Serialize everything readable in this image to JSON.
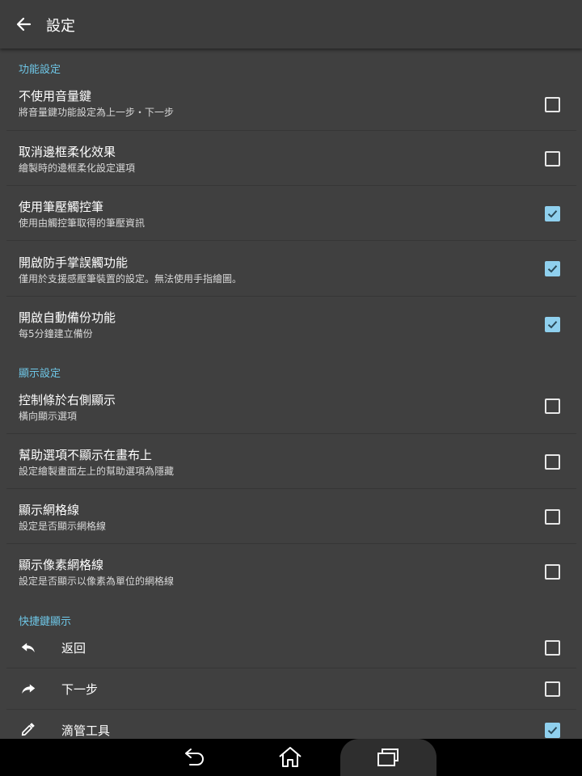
{
  "appbar": {
    "title": "設定",
    "back_icon": "arrow-left-icon"
  },
  "sections": [
    {
      "header": "功能設定",
      "items": [
        {
          "title": "不使用音量鍵",
          "subtitle": "將音量鍵功能設定為上一步・下一步",
          "checked": false
        },
        {
          "title": "取消邊框柔化效果",
          "subtitle": "繪製時的邊框柔化設定選項",
          "checked": false
        },
        {
          "title": "使用筆壓觸控筆",
          "subtitle": "使用由觸控筆取得的筆壓資訊",
          "checked": true
        },
        {
          "title": "開啟防手掌誤觸功能",
          "subtitle": "僅用於支援感壓筆裝置的設定。無法使用手指繪圖。",
          "checked": true
        },
        {
          "title": "開啟自動備份功能",
          "subtitle": "每5分鐘建立備份",
          "checked": true
        }
      ]
    },
    {
      "header": "顯示設定",
      "items": [
        {
          "title": "控制條於右側顯示",
          "subtitle": "橫向顯示選項",
          "checked": false
        },
        {
          "title": "幫助選項不顯示在畫布上",
          "subtitle": "設定繪製畫面左上的幫助選項為隱藏",
          "checked": false
        },
        {
          "title": "顯示網格線",
          "subtitle": "設定是否顯示網格線",
          "checked": false
        },
        {
          "title": "顯示像素網格線",
          "subtitle": "設定是否顯示以像素為單位的網格線",
          "checked": false
        }
      ]
    },
    {
      "header": "快捷鍵顯示",
      "shortcuts": [
        {
          "label": "返回",
          "icon": "undo-icon",
          "checked": false
        },
        {
          "label": "下一步",
          "icon": "redo-icon",
          "checked": false
        },
        {
          "label": "滴管工具",
          "icon": "eyedropper-icon",
          "checked": true
        }
      ]
    }
  ],
  "navbar": {
    "icons": [
      "back-nav-icon",
      "home-icon",
      "recent-apps-icon"
    ]
  },
  "colors": {
    "background": "#404040",
    "accent": "#6ec6e6",
    "checkbox_checked": "#8fd0ee",
    "navbar": "#000000"
  }
}
